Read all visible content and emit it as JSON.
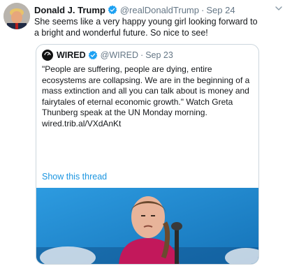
{
  "tweet": {
    "author_name": "Donald J. Trump",
    "author_handle": "@realDonaldTrump",
    "separator": "·",
    "time": "Sep 24",
    "text": "She seems like a very happy young girl looking forward to a bright and wonderful future. So nice to see!",
    "verified_icon": "verified-badge-icon",
    "menu_icon": "chevron-down-icon"
  },
  "quote": {
    "author_name": "WIRED",
    "author_handle": "@WIRED",
    "separator": "·",
    "time": "Sep 23",
    "text": "\"People are suffering, people are dying, entire ecosystems are collapsing. We are in the beginning of a mass extinction and all you can talk about is money and fairytales of eternal economic growth.\" Watch Greta Thunberg speak at the UN Monday morning. wired.trib.al/VXdAnKt",
    "show_thread": "Show this thread"
  },
  "colors": {
    "link": "#1b95e0",
    "verified": "#1da1f2",
    "muted": "#657786",
    "image_bg": "#1a86cc",
    "shirt": "#c2185b"
  }
}
